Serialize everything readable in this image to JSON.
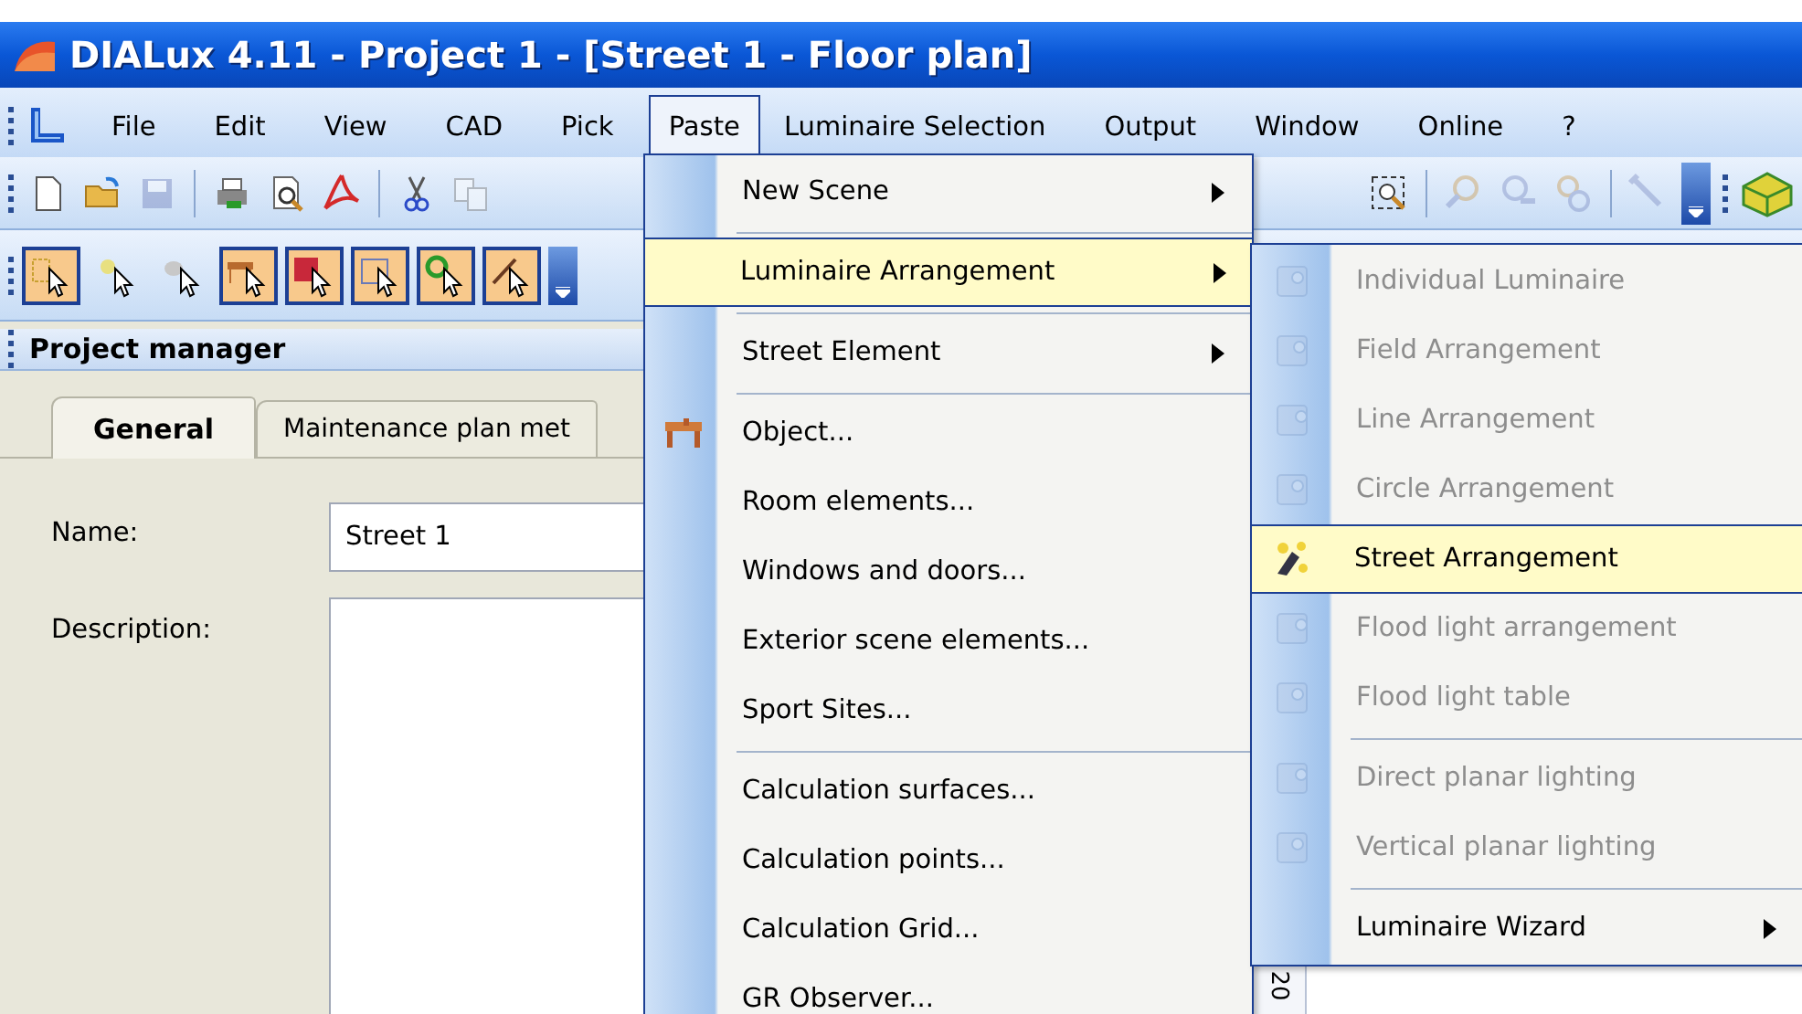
{
  "window": {
    "title": "DIALux 4.11 - Project 1 - [Street 1 - Floor plan]"
  },
  "menu_bar": [
    {
      "label": "File",
      "selected": false
    },
    {
      "label": "Edit",
      "selected": false
    },
    {
      "label": "View",
      "selected": false
    },
    {
      "label": "CAD",
      "selected": false
    },
    {
      "label": "Pick",
      "selected": false
    },
    {
      "label": "Paste",
      "selected": true
    },
    {
      "label": "Luminaire Selection",
      "selected": false
    },
    {
      "label": "Output",
      "selected": false
    },
    {
      "label": "Window",
      "selected": false
    },
    {
      "label": "Online",
      "selected": false
    },
    {
      "label": "?",
      "selected": false
    }
  ],
  "selection_toolbar": [
    {
      "checked": true
    },
    {
      "checked": false
    },
    {
      "checked": false
    },
    {
      "checked": true
    },
    {
      "checked": true
    },
    {
      "checked": true
    },
    {
      "checked": true
    },
    {
      "checked": true
    }
  ],
  "project_manager": {
    "title": "Project manager",
    "tabs": [
      {
        "label": "General",
        "selected": true
      },
      {
        "label": "Maintenance plan met",
        "selected": false
      }
    ],
    "name_label": "Name:",
    "name_value": "Street 1",
    "description_label": "Description:"
  },
  "paste_menu": [
    {
      "kind": "submenu",
      "label": "New Scene",
      "selected": false
    },
    {
      "kind": "separator"
    },
    {
      "kind": "submenu",
      "label": "Luminaire Arrangement",
      "selected": true
    },
    {
      "kind": "separator"
    },
    {
      "kind": "submenu",
      "label": "Street Element",
      "selected": false
    },
    {
      "kind": "separator"
    },
    {
      "kind": "icon_item",
      "label": "Object...",
      "selected": false
    },
    {
      "kind": "item",
      "label": "Room elements...",
      "selected": false
    },
    {
      "kind": "item",
      "label": "Windows and doors...",
      "selected": false
    },
    {
      "kind": "item",
      "label": "Exterior scene elements...",
      "selected": false
    },
    {
      "kind": "item",
      "label": "Sport Sites...",
      "selected": false
    },
    {
      "kind": "separator"
    },
    {
      "kind": "item",
      "label": "Calculation surfaces...",
      "selected": false
    },
    {
      "kind": "item",
      "label": "Calculation points...",
      "selected": false
    },
    {
      "kind": "item",
      "label": "Calculation Grid...",
      "selected": false
    },
    {
      "kind": "item",
      "label": "GR Observer...",
      "selected": false
    }
  ],
  "luminaire_submenu": [
    {
      "kind": "item",
      "label": "Individual Luminaire",
      "disabled": true,
      "selected": false
    },
    {
      "kind": "item",
      "label": "Field Arrangement",
      "disabled": true,
      "selected": false
    },
    {
      "kind": "item",
      "label": "Line Arrangement",
      "disabled": true,
      "selected": false
    },
    {
      "kind": "item",
      "label": "Circle Arrangement",
      "disabled": true,
      "selected": false
    },
    {
      "kind": "item",
      "label": "Street Arrangement",
      "disabled": false,
      "selected": true
    },
    {
      "kind": "item",
      "label": "Flood light arrangement",
      "disabled": true,
      "selected": false
    },
    {
      "kind": "item",
      "label": "Flood light table",
      "disabled": true,
      "selected": false
    },
    {
      "kind": "separator"
    },
    {
      "kind": "item",
      "label": "Direct planar lighting",
      "disabled": true,
      "selected": false
    },
    {
      "kind": "item",
      "label": "Vertical planar lighting",
      "disabled": true,
      "selected": false
    },
    {
      "kind": "separator"
    },
    {
      "kind": "submenu",
      "label": "Luminaire Wizard",
      "disabled": false,
      "selected": false
    }
  ],
  "ruler": {
    "label": "20"
  }
}
